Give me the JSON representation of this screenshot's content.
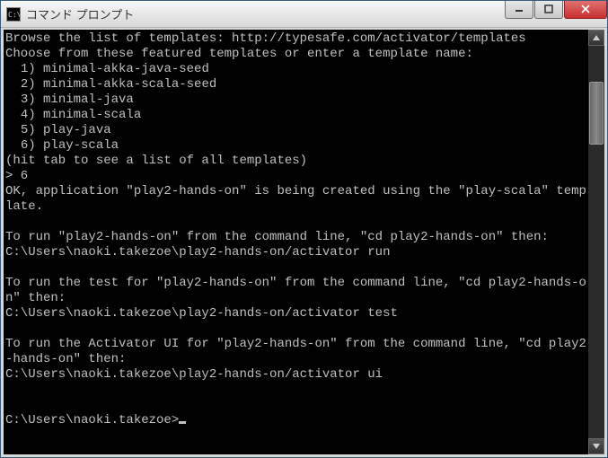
{
  "window": {
    "icon_text": "C:\\",
    "title": "コマンド プロンプト"
  },
  "console": {
    "lines": [
      "Browse the list of templates: http://typesafe.com/activator/templates",
      "Choose from these featured templates or enter a template name:",
      "  1) minimal-akka-java-seed",
      "  2) minimal-akka-scala-seed",
      "  3) minimal-java",
      "  4) minimal-scala",
      "  5) play-java",
      "  6) play-scala",
      "(hit tab to see a list of all templates)",
      "> 6",
      "OK, application \"play2-hands-on\" is being created using the \"play-scala\" template.",
      "",
      "To run \"play2-hands-on\" from the command line, \"cd play2-hands-on\" then:",
      "C:\\Users\\naoki.takezoe\\play2-hands-on/activator run",
      "",
      "To run the test for \"play2-hands-on\" from the command line, \"cd play2-hands-on\" then:",
      "C:\\Users\\naoki.takezoe\\play2-hands-on/activator test",
      "",
      "To run the Activator UI for \"play2-hands-on\" from the command line, \"cd play2-hands-on\" then:",
      "C:\\Users\\naoki.takezoe\\play2-hands-on/activator ui",
      "",
      ""
    ],
    "prompt": "C:\\Users\\naoki.takezoe>"
  }
}
